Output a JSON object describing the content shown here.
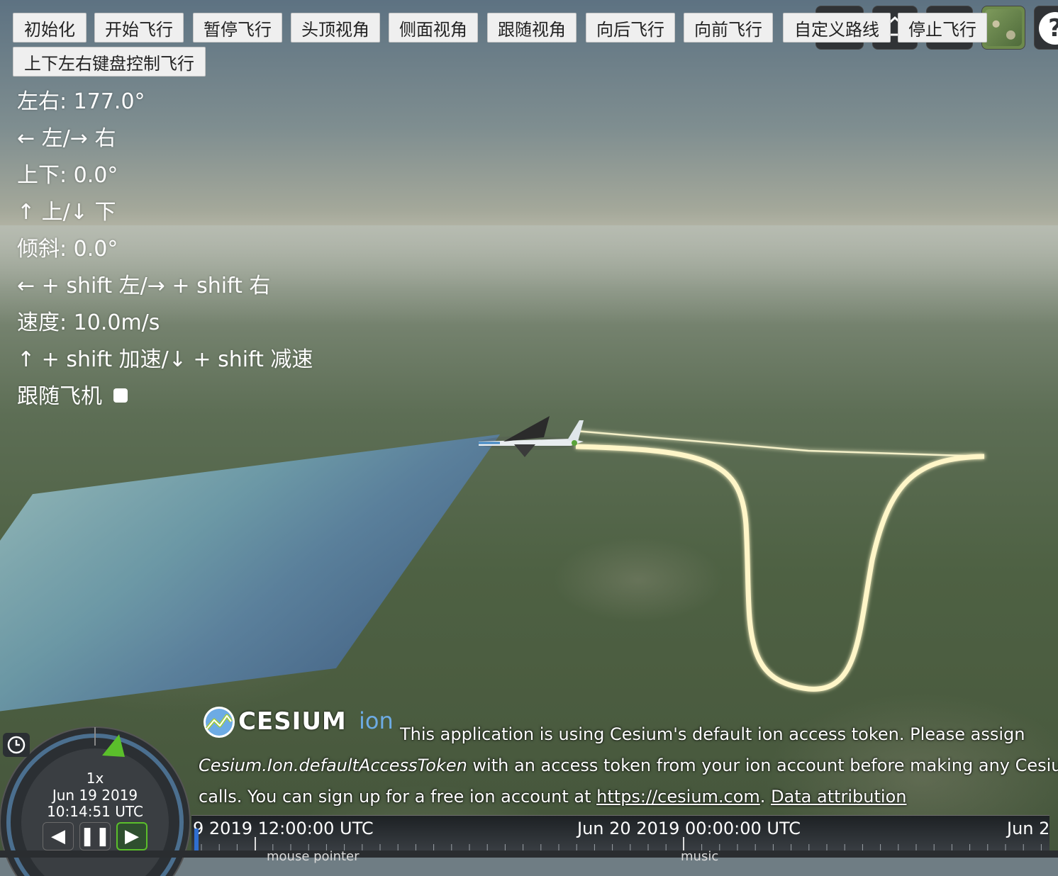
{
  "toolbar": {
    "buttons": [
      "初始化",
      "开始飞行",
      "暂停飞行",
      "头顶视角",
      "侧面视角",
      "跟随视角",
      "向后飞行",
      "向前飞行",
      "自定义路线",
      "停止飞行"
    ],
    "keyboard_control": "上下左右键盘控制飞行"
  },
  "info": {
    "heading": "左右: 177.0°",
    "heading_keys": "← 左/→ 右",
    "pitch": "上下: 0.0°",
    "pitch_keys": "↑ 上/↓ 下",
    "roll": "倾斜: 0.0°",
    "roll_keys": "← + shift 左/→ + shift 右",
    "speed": "速度: 10.0m/s",
    "speed_keys": "↑ + shift 加速/↓ + shift 减速",
    "follow_label": "跟随飞机"
  },
  "credits": {
    "logo_text": "CESIUM",
    "logo_suffix": "ion",
    "line1": "This application is using Cesium's default ion access token. Please assign",
    "line2_italic": "Cesium.Ion.defaultAccessToken",
    "line2_rest": " with an access token from your ion account before making any Cesium A",
    "line3_pre": "calls. You can sign up for a free ion account at ",
    "line3_link": "https://cesium.com",
    "line3_mid": ". ",
    "line3_link2": "Data attribution"
  },
  "animation": {
    "speed": "1x",
    "date": "Jun 19 2019",
    "time": "10:14:51 UTC"
  },
  "timeline": {
    "labels": [
      "9 2019 12:00:00 UTC",
      "Jun 20 2019 00:00:00 UTC",
      "Jun 2"
    ]
  },
  "bottom": {
    "text1": "mouse pointer",
    "text2": "music"
  },
  "widgets": {
    "help": "?"
  }
}
